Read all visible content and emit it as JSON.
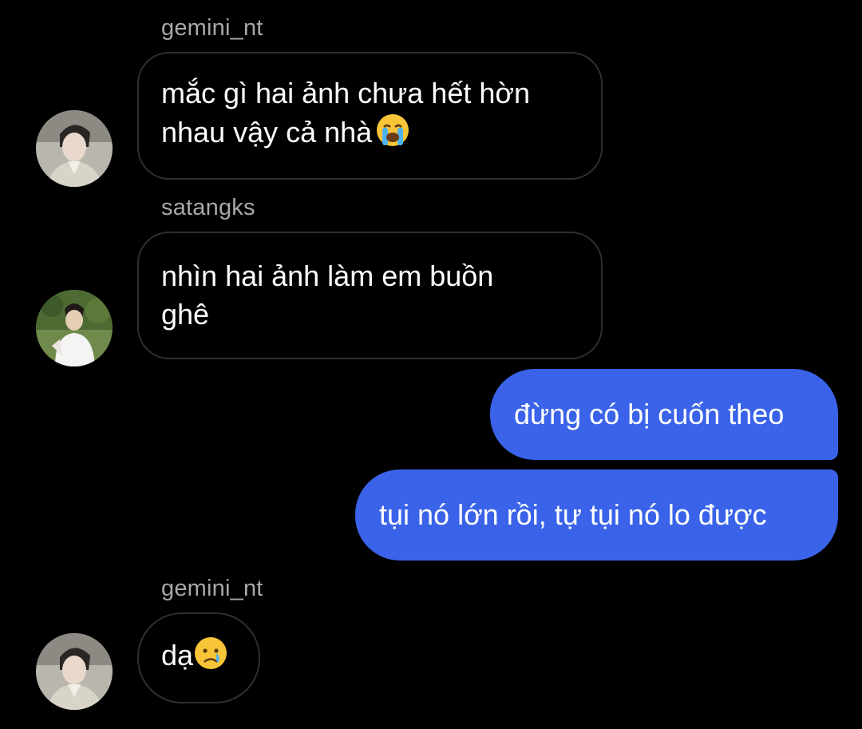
{
  "messages": [
    {
      "sender": "gemini_nt",
      "text": "mắc gì hai ảnh chưa hết hờn nhau vậy cả nhà",
      "emoji": "loudly-crying-face-emoji"
    },
    {
      "sender": "satangks",
      "text": "nhìn hai ảnh làm em buồn ghê"
    },
    {
      "outgoing": true,
      "text": "đừng có bị cuốn theo"
    },
    {
      "outgoing": true,
      "text": "tụi nó lớn rồi, tự tụi nó lo được"
    },
    {
      "sender": "gemini_nt",
      "text": "dạ",
      "emoji": "crying-face-emoji"
    }
  ],
  "colors": {
    "background": "#000000",
    "outgoing_bubble": "#3a63ea",
    "incoming_border": "#2f2f2f",
    "sender_name": "#a8a8a8"
  }
}
